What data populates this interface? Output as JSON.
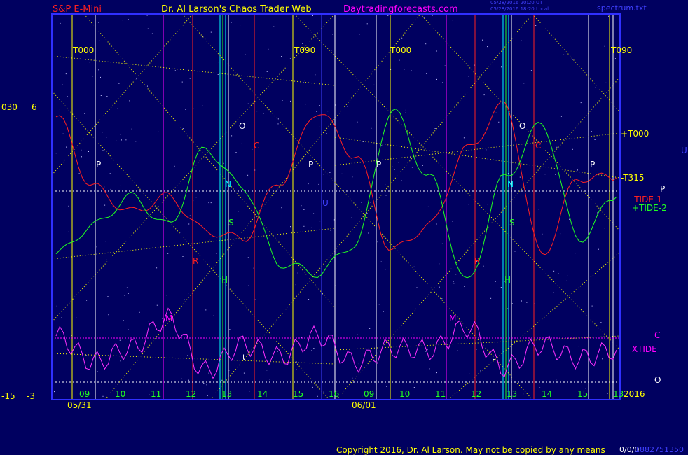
{
  "header": {
    "symbol": "S&P E-Mini",
    "author": "Dr. Al Larson's Chaos Trader Web",
    "site": "Daytradingforecasts.com",
    "stamp_line1": "05/28/2016 20:20 UT",
    "stamp_line2": "05/28/2016 18:20 Local",
    "file": "spectrum.txt"
  },
  "left_axis": {
    "label_030": "030",
    "label_6": "6",
    "label_neg15": "-15",
    "label_neg3": "-3"
  },
  "right_labels": {
    "t000": "+T000",
    "t315": "-T315",
    "p": "P",
    "tide1": "-TIDE-1",
    "tide2": "+TIDE-2",
    "c": "C",
    "xtide": "XTIDE",
    "o": "O",
    "year": "2016",
    "u": "U"
  },
  "top_markers": [
    "T000",
    "T090",
    "T000",
    "T090"
  ],
  "planet_labels": {
    "p": "P",
    "o": "O",
    "c": "C",
    "n": "N",
    "s": "S",
    "r": "R",
    "h": "H",
    "m": "M",
    "u": "U",
    "t": "t"
  },
  "x_axis": {
    "hours": [
      "09",
      "10",
      "11",
      "12",
      "13",
      "14",
      "15",
      "16",
      "09",
      "10",
      "11",
      "12",
      "13",
      "14",
      "15",
      "13"
    ],
    "dates": [
      "05/31",
      "06/01"
    ]
  },
  "footer": {
    "copyright": "Copyright 2016, Dr. Al Larson. May not be copied by any means",
    "code": "0/0/0",
    "id": "1882751350"
  },
  "colors": {
    "background": "#000060",
    "plot_border": "#3030ff",
    "tide1": "#ff2020",
    "tide2": "#20ff20",
    "xtide": "#ff30ff",
    "yellow": "#ffff00",
    "magenta": "#ff00ff",
    "cyan": "#00ffff",
    "blue_text": "#4040ff"
  },
  "chart_data": {
    "type": "line",
    "title": "S&P E-Mini",
    "x": [
      "05/31 09",
      "05/31 10",
      "05/31 11",
      "05/31 12",
      "05/31 13",
      "05/31 14",
      "05/31 15",
      "05/31 16",
      "06/01 09",
      "06/01 10",
      "06/01 11",
      "06/01 12",
      "06/01 13",
      "06/01 14",
      "06/01 15",
      "06/01 16"
    ],
    "series": [
      {
        "name": "-TIDE-1",
        "values": [
          5.2,
          1.5,
          0.2,
          1.0,
          -0.8,
          -1.2,
          1.8,
          5.5,
          3.2,
          -1.8,
          -0.5,
          3.5,
          5.8,
          -2.0,
          2.0,
          2.0
        ]
      },
      {
        "name": "+TIDE-2",
        "values": [
          -2.0,
          -0.5,
          1.0,
          -0.5,
          3.5,
          1.5,
          -2.5,
          -3.0,
          -1.5,
          5.5,
          2.0,
          -3.5,
          2.0,
          4.8,
          -1.2,
          1.0
        ]
      },
      {
        "name": "XTIDE",
        "values": [
          1.0,
          -0.5,
          0.3,
          2.0,
          -1.0,
          0.5,
          -0.2,
          1.0,
          -0.5,
          0.3,
          0.2,
          1.5,
          -0.8,
          0.5,
          -0.3,
          0.2
        ]
      }
    ]
  }
}
